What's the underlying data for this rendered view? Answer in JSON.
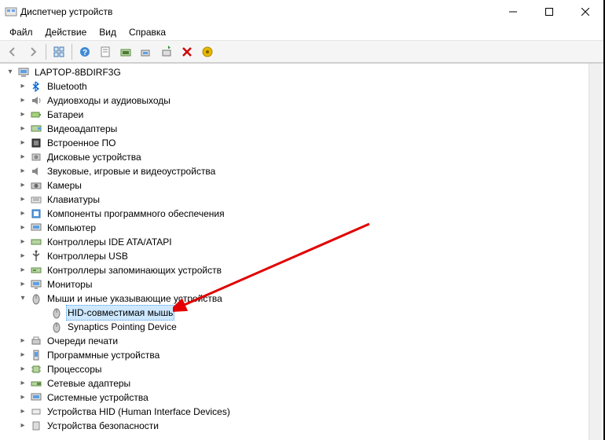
{
  "window": {
    "title": "Диспетчер устройств"
  },
  "menu": {
    "file": "Файл",
    "action": "Действие",
    "view": "Вид",
    "help": "Справка"
  },
  "tree": {
    "root": "LAPTOP-8BDIRF3G",
    "items": [
      {
        "label": "Bluetooth"
      },
      {
        "label": "Аудиовходы и аудиовыходы"
      },
      {
        "label": "Батареи"
      },
      {
        "label": "Видеоадаптеры"
      },
      {
        "label": "Встроенное ПО"
      },
      {
        "label": "Дисковые устройства"
      },
      {
        "label": "Звуковые, игровые и видеоустройства"
      },
      {
        "label": "Камеры"
      },
      {
        "label": "Клавиатуры"
      },
      {
        "label": "Компоненты программного обеспечения"
      },
      {
        "label": "Компьютер"
      },
      {
        "label": "Контроллеры IDE ATA/ATAPI"
      },
      {
        "label": "Контроллеры USB"
      },
      {
        "label": "Контроллеры запоминающих устройств"
      },
      {
        "label": "Мониторы"
      },
      {
        "label": "Мыши и иные указывающие устройства"
      },
      {
        "label": "Очереди печати"
      },
      {
        "label": "Программные устройства"
      },
      {
        "label": "Процессоры"
      },
      {
        "label": "Сетевые адаптеры"
      },
      {
        "label": "Системные устройства"
      },
      {
        "label": "Устройства HID (Human Interface Devices)"
      },
      {
        "label": "Устройства безопасности"
      }
    ],
    "mouse_children": [
      {
        "label": "HID-совместимая мышь"
      },
      {
        "label": "Synaptics Pointing Device"
      }
    ]
  }
}
